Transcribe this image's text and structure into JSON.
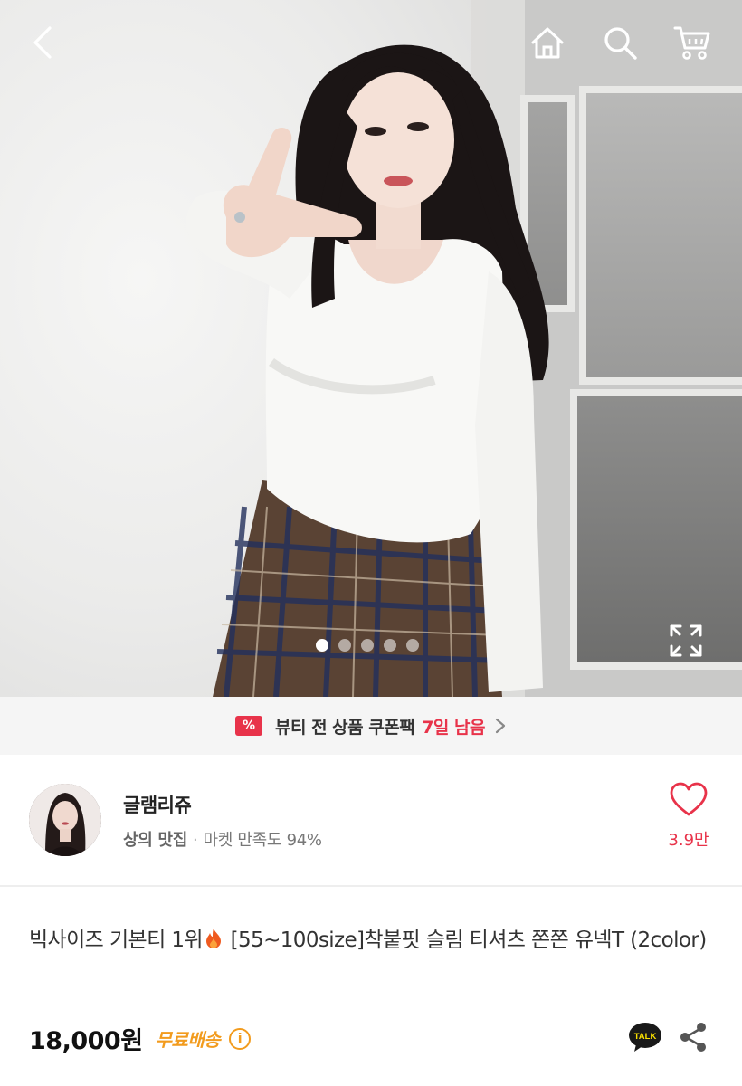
{
  "nav": {
    "back_icon": "chevron-left-icon",
    "home_icon": "home-icon",
    "search_icon": "search-icon",
    "cart_icon": "cart-icon"
  },
  "gallery": {
    "image_count": 5,
    "active_index": 0,
    "expand_icon": "expand-icon"
  },
  "coupon": {
    "icon_symbol": "%",
    "text": "뷰티 전 상품 쿠폰팩",
    "days_left": "7일 남음",
    "accent": "#e8334a"
  },
  "seller": {
    "name": "글램리쥬",
    "tag": "상의 맛집",
    "separator": "·",
    "satisfaction": "마켓 만족도 94%",
    "likes": "3.9만"
  },
  "product": {
    "title_part1": "빅사이즈 기본티 1위",
    "title_part2": " [55~100size]착붙핏 슬림 티셔츠 쫀쫀 유넥T (2color)",
    "price": "18,000원",
    "shipping": "무료배송",
    "info_symbol": "i",
    "talk_label": "TALK",
    "shipping_color": "#f29b1d"
  }
}
